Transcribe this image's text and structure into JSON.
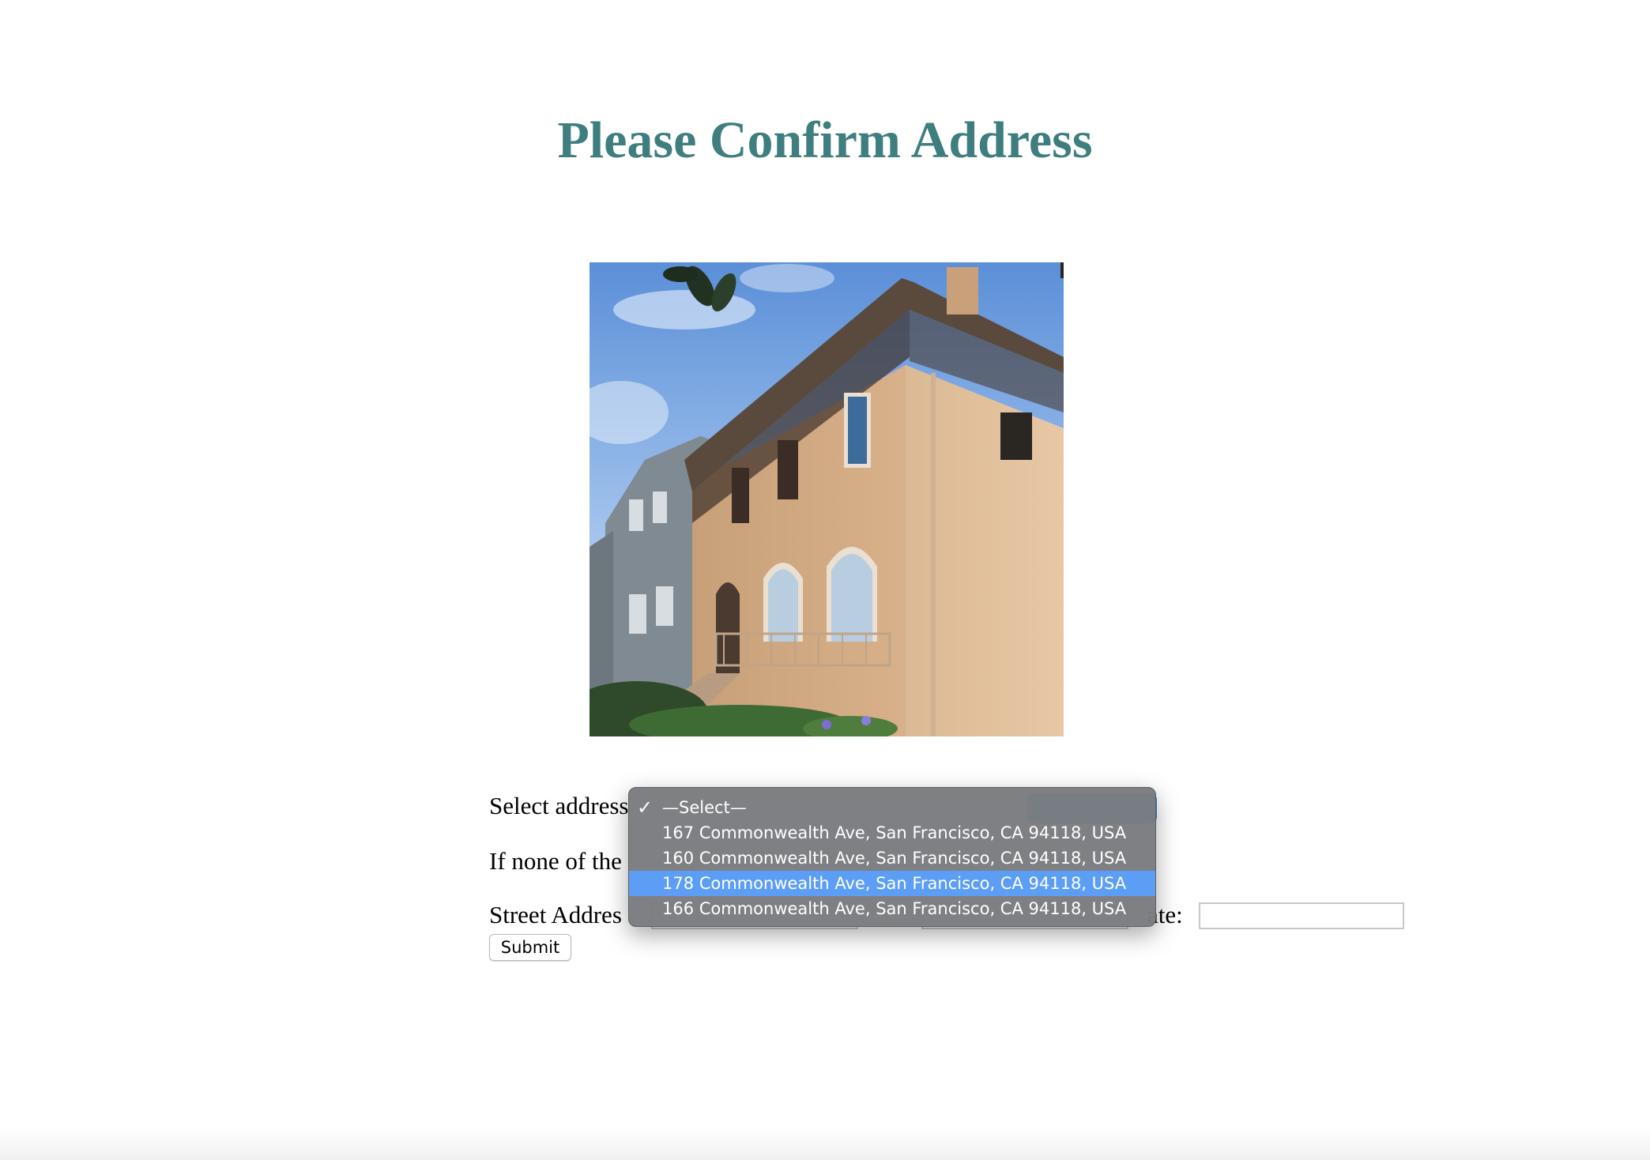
{
  "page": {
    "title": "Please Confirm Address",
    "title_color": "#3f7e7f"
  },
  "photo": {
    "icon": "house-photo",
    "description_visible": false
  },
  "form": {
    "select_label": "Select address",
    "none_label": "If none of the",
    "street_label": "Street Addres",
    "state_label": "ate:",
    "street_value": "",
    "city_value": "",
    "state_value": "",
    "submit_label": "Submit"
  },
  "dropdown": {
    "check_icon": "✓",
    "options": [
      {
        "label": "—Select—",
        "selected": true,
        "highlighted": false
      },
      {
        "label": "167 Commonwealth Ave, San Francisco, CA 94118, USA",
        "selected": false,
        "highlighted": false
      },
      {
        "label": "160 Commonwealth Ave, San Francisco, CA 94118, USA",
        "selected": false,
        "highlighted": false
      },
      {
        "label": "178 Commonwealth Ave, San Francisco, CA 94118, USA",
        "selected": false,
        "highlighted": true
      },
      {
        "label": "166 Commonwealth Ave, San Francisco, CA 94118, USA",
        "selected": false,
        "highlighted": false
      }
    ],
    "highlight_color": "#5c9ef5",
    "menu_color": "#7a7c80"
  }
}
